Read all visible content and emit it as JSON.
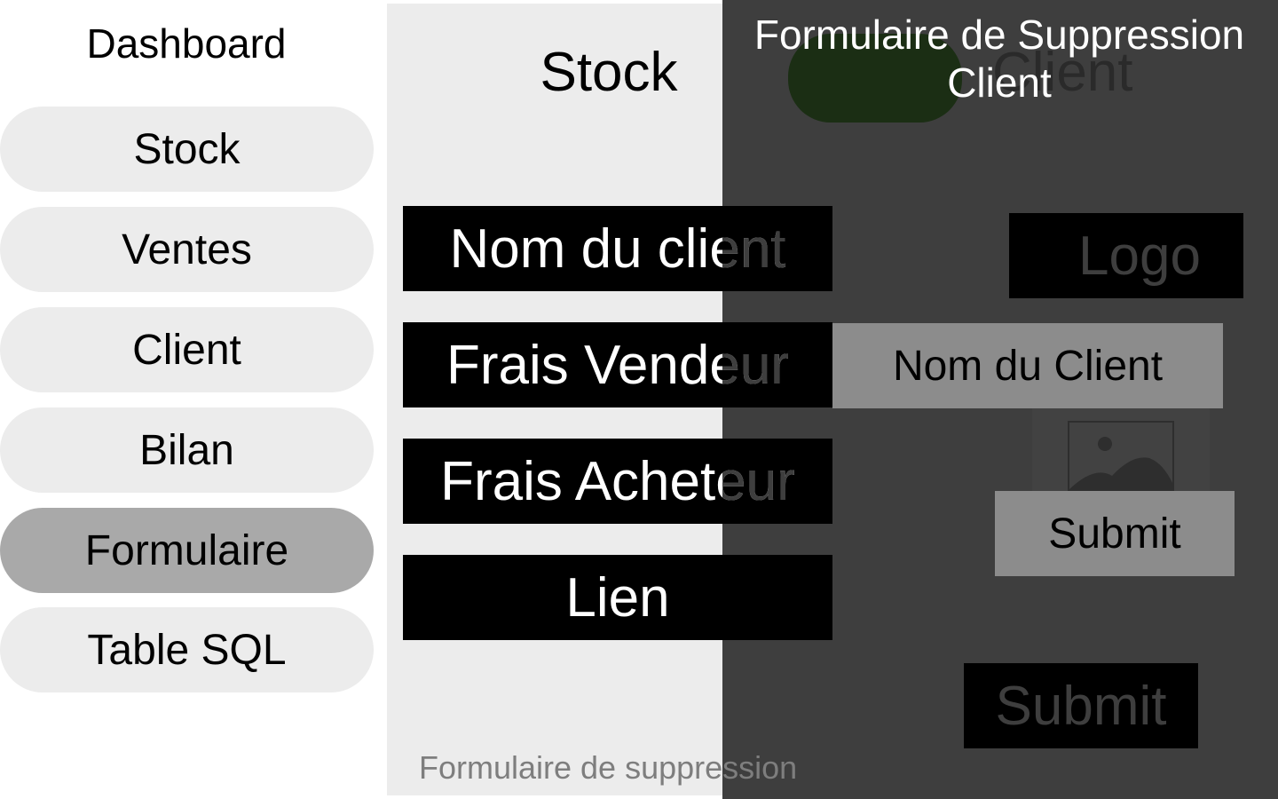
{
  "sidebar": {
    "title": "Dashboard",
    "items": [
      {
        "label": "Stock"
      },
      {
        "label": "Ventes"
      },
      {
        "label": "Client"
      },
      {
        "label": "Bilan"
      },
      {
        "label": "Formulaire"
      },
      {
        "label": "Table SQL"
      }
    ],
    "active_item": "Formulaire"
  },
  "stock": {
    "title": "Stock",
    "fields": [
      {
        "label": "Nom du client"
      },
      {
        "label": "Frais Vendeur"
      },
      {
        "label": "Frais Acheteur"
      },
      {
        "label": "Lien"
      }
    ],
    "footer": "Formulaire de suppression"
  },
  "client_panel": {
    "heading": "Client",
    "form_title": "Formulaire de Suppression Client",
    "logo_label": "Logo",
    "client_name_label": "Nom du Client",
    "submit_label": "Submit",
    "submit_dark_label": "Submit"
  },
  "colors": {
    "sidebar_item": "#ececec",
    "sidebar_item_active": "#a9a9a9",
    "dark_panel": "#3e3e3e",
    "field_bg": "#000000",
    "green_blob": "#1b2e14"
  },
  "icons": [
    "image-placeholder-icon"
  ]
}
